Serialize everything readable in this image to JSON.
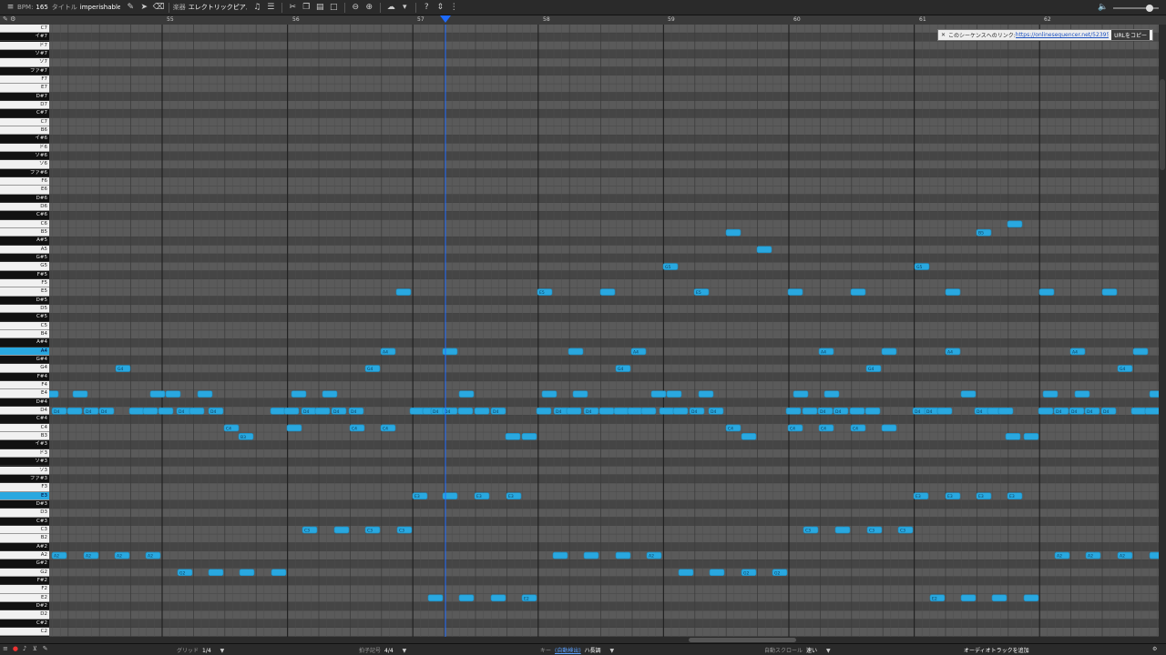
{
  "toolbar": {
    "bpm_label": "BPM:",
    "bpm_value": "165",
    "title_label": "タイトル",
    "title_value": "imperishable va",
    "instrument_label": "楽器",
    "instrument_value": "エレクトリックピアノ"
  },
  "link_bar": {
    "close": "✕",
    "text": "このシーケンスへのリンク:",
    "url": "https://onlinesequencer.net/5239597",
    "copy_label": "URLをコピー"
  },
  "ruler": {
    "measures": [
      "55",
      "56",
      "57",
      "58",
      "59",
      "60",
      "61",
      "62"
    ]
  },
  "keyboard": {
    "keys": [
      "C7",
      "イ#7",
      "ド7",
      "ソ#7",
      "ソ7",
      "ファ#7",
      "F7",
      "E7",
      "D#7",
      "D7",
      "C#7",
      "C7",
      "B6",
      "イ#6",
      "ド6",
      "ソ#6",
      "ソ6",
      "ファ#6",
      "F6",
      "E6",
      "D#6",
      "D6",
      "C#6",
      "C6",
      "B5",
      "A#5",
      "A5",
      "G#5",
      "G5",
      "F#5",
      "F5",
      "E5",
      "D#5",
      "D5",
      "C#5",
      "C5",
      "B4",
      "A#4",
      "A4",
      "G#4",
      "G4",
      "F#4",
      "F4",
      "E4",
      "D#4",
      "D4",
      "C#4",
      "C4",
      "B3",
      "イ#3",
      "ド3",
      "ソ#3",
      "ソ3",
      "ファ#3",
      "F3",
      "E3",
      "D#3",
      "D3",
      "C#3",
      "C3",
      "B2",
      "A#2",
      "A2",
      "G#2",
      "G2",
      "F#2",
      "F2",
      "E2",
      "D#2",
      "D2",
      "C#2",
      "C2"
    ],
    "highlighted": [
      "A4",
      "E3"
    ]
  },
  "bottombar": {
    "grid_label": "グリッド",
    "grid_value": "1/4",
    "time_sig_label": "拍子記号",
    "time_sig_value": "4/4",
    "key_label": "キー",
    "key_auto": "(自動検出)",
    "key_value": "ハ長調",
    "autoscroll_label": "自動スクロール",
    "autoscroll_value": "速い",
    "add_audio_track": "オーディオトラックを追加"
  },
  "colors": {
    "note": "#29a8e0",
    "note_border": "#1a86b8",
    "playhead": "#1e6bff",
    "white_row": "#5a5a5a",
    "black_row": "#454545"
  },
  "notes": {
    "C6": [
      [
        "",
        1114
      ]
    ],
    "B5": [
      [
        "",
        805
      ],
      [
        "B5",
        1080
      ]
    ],
    "A5": [
      [
        "",
        839
      ]
    ],
    "G5": [
      [
        "G5",
        736
      ],
      [
        "G5",
        1012
      ]
    ],
    "E5": [
      [
        "",
        443
      ],
      [
        "E5",
        598
      ],
      [
        "",
        667
      ],
      [
        "E5",
        770
      ],
      [
        "",
        873
      ],
      [
        "",
        942
      ],
      [
        "",
        1046
      ],
      [
        "",
        1149
      ],
      [
        "",
        1218
      ]
    ],
    "A4": [
      [
        "A4",
        426
      ],
      [
        "",
        494
      ],
      [
        "",
        632
      ],
      [
        "A4",
        701
      ],
      [
        "A4",
        907
      ],
      [
        "",
        976
      ],
      [
        "A4",
        1046
      ],
      [
        "A4",
        1183
      ],
      [
        "",
        1252
      ]
    ],
    "G4": [
      [
        "G4",
        135
      ],
      [
        "G4",
        409
      ],
      [
        "G4",
        684
      ],
      [
        "G4",
        959
      ],
      [
        "G4",
        1235
      ]
    ],
    "E4": [
      [
        "",
        56
      ],
      [
        "",
        88
      ],
      [
        "",
        173
      ],
      [
        "",
        190
      ],
      [
        "",
        225
      ],
      [
        "",
        328
      ],
      [
        "",
        362
      ],
      [
        "",
        512
      ],
      [
        "",
        603
      ],
      [
        "",
        637
      ],
      [
        "",
        723
      ],
      [
        "",
        740
      ],
      [
        "",
        775
      ],
      [
        "",
        879
      ],
      [
        "",
        913
      ],
      [
        "",
        1063
      ],
      [
        "",
        1153
      ],
      [
        "",
        1188
      ],
      [
        "",
        1270
      ]
    ],
    "D4": [
      [
        "D4",
        65
      ],
      [
        "",
        82
      ],
      [
        "D4",
        100
      ],
      [
        "D4",
        117
      ],
      [
        "",
        150
      ],
      [
        "",
        165
      ],
      [
        "",
        182
      ],
      [
        "D4",
        202
      ],
      [
        "",
        216
      ],
      [
        "D4",
        237
      ],
      [
        "",
        305
      ],
      [
        "",
        320
      ],
      [
        "D4",
        339
      ],
      [
        "",
        354
      ],
      [
        "D4",
        372
      ],
      [
        "D4",
        391
      ],
      [
        "",
        458
      ],
      [
        "",
        472
      ],
      [
        "D4",
        481
      ],
      [
        "D4",
        494
      ],
      [
        "",
        511
      ],
      [
        "",
        529
      ],
      [
        "D4",
        547
      ],
      [
        "",
        597
      ],
      [
        "D4",
        616
      ],
      [
        "",
        630
      ],
      [
        "D4",
        649
      ],
      [
        "",
        666
      ],
      [
        "",
        682
      ],
      [
        "",
        697
      ],
      [
        "",
        712
      ],
      [
        "",
        732
      ],
      [
        "",
        747
      ],
      [
        "D4",
        765
      ],
      [
        "D4",
        786
      ],
      [
        "",
        871
      ],
      [
        "",
        889
      ],
      [
        "D4",
        906
      ],
      [
        "D4",
        923
      ],
      [
        "",
        941
      ],
      [
        "",
        958
      ],
      [
        "D4",
        1010
      ],
      [
        "D4",
        1023
      ],
      [
        "",
        1037
      ],
      [
        "D4",
        1078
      ],
      [
        "",
        1092
      ],
      [
        "",
        1104
      ],
      [
        "",
        1148
      ],
      [
        "D4",
        1165
      ],
      [
        "D4",
        1182
      ],
      [
        "D4",
        1199
      ],
      [
        "D4",
        1217
      ],
      [
        "",
        1250
      ],
      [
        "",
        1265
      ]
    ],
    "C4": [
      [
        "C4",
        254
      ],
      [
        "",
        323
      ],
      [
        "C4",
        392
      ],
      [
        "C4",
        426
      ],
      [
        "C4",
        805
      ],
      [
        "C4",
        873
      ],
      [
        "C4",
        907
      ],
      [
        "C4",
        942
      ],
      [
        "",
        976
      ]
    ],
    "B3": [
      [
        "B3",
        270
      ],
      [
        "",
        563
      ],
      [
        "",
        581
      ],
      [
        "",
        822
      ],
      [
        "",
        1112
      ],
      [
        "",
        1132
      ]
    ],
    "A3": [
      [
        "",
        56
      ],
      [
        "A3",
        82
      ],
      [
        "",
        117
      ],
      [
        "",
        151
      ],
      [
        "A3",
        290
      ],
      [
        "",
        306
      ],
      [
        "A3",
        598
      ],
      [
        "",
        632
      ],
      [
        "A3",
        666
      ],
      [
        "",
        702
      ],
      [
        "",
        837
      ],
      [
        "",
        857
      ],
      [
        "",
        1149
      ],
      [
        "A3",
        1183
      ],
      [
        "",
        1217
      ],
      [
        "A3",
        1252
      ]
    ],
    "G3": [
      [
        "G3",
        185
      ],
      [
        "",
        220
      ],
      [
        "G3",
        254
      ],
      [
        "G3",
        288
      ],
      [
        "",
        736
      ],
      [
        "",
        770
      ],
      [
        "",
        805
      ],
      [
        "G3",
        840
      ]
    ],
    "E3": [
      [
        "E3",
        461
      ],
      [
        "",
        494
      ],
      [
        "E3",
        529
      ],
      [
        "E3",
        564
      ],
      [
        "E3",
        1011
      ],
      [
        "E3",
        1046
      ],
      [
        "E3",
        1080
      ],
      [
        "E3",
        1114
      ]
    ],
    "C3": [
      [
        "C3",
        340
      ],
      [
        "",
        375
      ],
      [
        "C3",
        409
      ],
      [
        "C3",
        444
      ],
      [
        "C3",
        890
      ],
      [
        "",
        925
      ],
      [
        "C3",
        960
      ],
      [
        "C3",
        994
      ]
    ],
    "A2": [
      [
        "A2",
        65
      ],
      [
        "A2",
        100
      ],
      [
        "A2",
        134
      ],
      [
        "A2",
        168
      ],
      [
        "",
        615
      ],
      [
        "",
        649
      ],
      [
        "",
        684
      ],
      [
        "A2",
        718
      ],
      [
        "A2",
        1166
      ],
      [
        "A2",
        1200
      ],
      [
        "A2",
        1235
      ],
      [
        "",
        1270
      ]
    ],
    "G2": [
      [
        "G2",
        203
      ],
      [
        "",
        237
      ],
      [
        "",
        271
      ],
      [
        "",
        306
      ],
      [
        "",
        753
      ],
      [
        "",
        787
      ],
      [
        "G2",
        822
      ],
      [
        "G2",
        856
      ]
    ],
    "E2": [
      [
        "",
        478
      ],
      [
        "",
        512
      ],
      [
        "",
        547
      ],
      [
        "E2",
        581
      ],
      [
        "E2",
        1029
      ],
      [
        "",
        1063
      ],
      [
        "",
        1097
      ],
      [
        "",
        1132
      ]
    ]
  }
}
